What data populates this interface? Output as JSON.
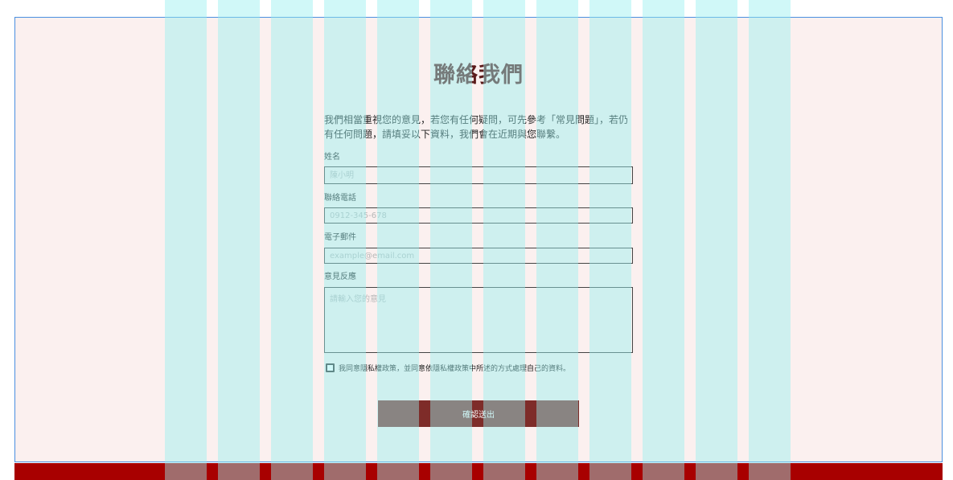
{
  "colors": {
    "page_background": "#fbf0ef",
    "frame_border": "#4a8fe0",
    "accent": "#a80000",
    "submit_button": "#7e2c29",
    "title": "#5a1a1a",
    "grid_overlay": "rgba(150,240,240,0.45)"
  },
  "contact": {
    "title": "聯絡我們",
    "intro": "我們相當重視您的意見，若您有任何疑問，可先參考「常見問題」，若仍有任何問題，請填妥以下資料，我們會在近期與您聯繫。"
  },
  "form": {
    "name": {
      "label": "姓名",
      "placeholder": "陳小明"
    },
    "phone": {
      "label": "聯絡電話",
      "placeholder": "0912-345-678"
    },
    "email": {
      "label": "電子郵件",
      "placeholder": "example@email.com"
    },
    "feedback": {
      "label": "意見反應",
      "placeholder": "請輸入您的意見"
    },
    "consent": {
      "text": "我同意隱私權政策，並同意依隱私權政策中所述的方式處理自己的資料。",
      "checked": false
    },
    "submit_label": "確認送出"
  },
  "icons": {
    "consent_checkbox": "checkbox-icon"
  }
}
